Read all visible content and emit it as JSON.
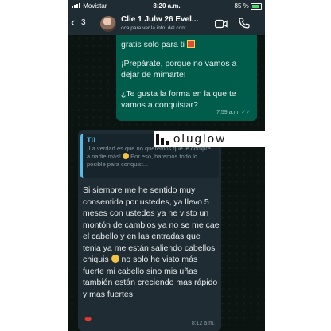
{
  "status_bar": {
    "carrier": "Movistar",
    "time": "8:20 a.m.",
    "battery": "85 %"
  },
  "header": {
    "back_count": "3",
    "contact_name": "Clie 1 Julw 26 Evel...",
    "subtitle": "oca para ver la info. del cont..."
  },
  "messages": {
    "outgoing": {
      "line1": "gratis solo para ti",
      "line2": "¡Prepárate, porque no vamos a dejar de mimarte!",
      "line3": "¿Te gusta la forma en la que te vamos a conquistar?",
      "time": "7:59 a.m."
    },
    "incoming": {
      "quote_author": "Tú",
      "quote_text_1": "¡La verdad es que no queremos que le compre a nadie más!",
      "quote_text_2": "Por eso, haremos todo lo posible para conquist...",
      "body_1": "Si siempre me he sentido muy consentida por ustedes, ya llevo 5 meses con ustedes ya he visto un montón de cambios ya no se me cae el cabello y en las entradas que tenia ya me están saliendo cabellos chiquis",
      "body_2": "no solo he visto más fuerte mi cabello sino mis uñas también están creciendo mas rápido y mas fuertes",
      "time": "8:12 a.m."
    },
    "reaction": "❤"
  },
  "logo": {
    "text": "oluglow"
  },
  "colors": {
    "outgoing_bubble": "#005c4b",
    "incoming_bubble": "#1f2c34",
    "accent": "#53bdeb"
  }
}
